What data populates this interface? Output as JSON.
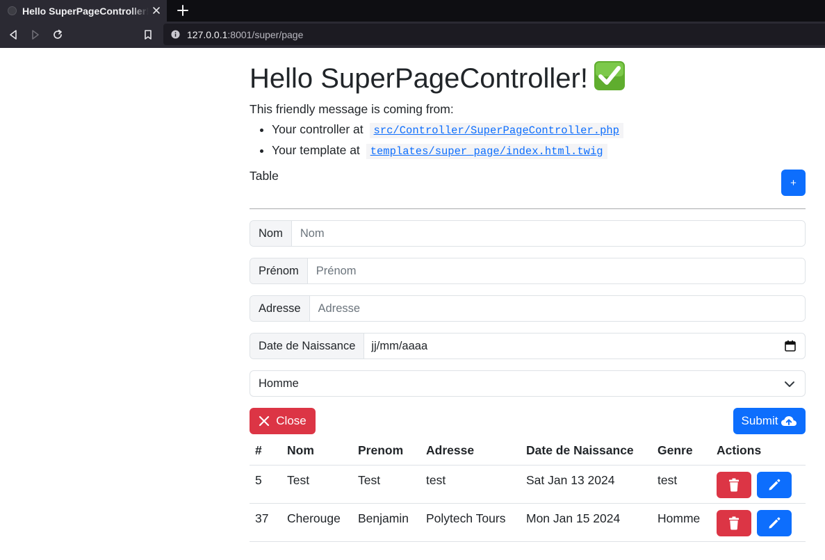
{
  "browser": {
    "tab_title": "Hello SuperPageController!",
    "url_host": "127.0.0.1",
    "url_rest": ":8001/super/page"
  },
  "page": {
    "heading": "Hello SuperPageController!",
    "heading_icon": "check-mark-icon",
    "intro": "This friendly message is coming from:",
    "controller_prefix": "Your controller at",
    "controller_path": "src/Controller/SuperPageController.php",
    "template_prefix": "Your template at",
    "template_path": "templates/super_page/index.html.twig",
    "table_label": "Table",
    "add_button": "+"
  },
  "form": {
    "nom_label": "Nom",
    "nom_placeholder": "Nom",
    "prenom_label": "Prénom",
    "prenom_placeholder": "Prénom",
    "adresse_label": "Adresse",
    "adresse_placeholder": "Adresse",
    "date_label": "Date de Naissance",
    "date_value": "jj/mm/aaaa",
    "genre_selected": "Homme",
    "close_label": "Close",
    "submit_label": "Submit"
  },
  "table": {
    "headers": [
      "#",
      "Nom",
      "Prenom",
      "Adresse",
      "Date de Naissance",
      "Genre",
      "Actions"
    ],
    "rows": [
      {
        "id": "5",
        "nom": "Test",
        "prenom": "Test",
        "adresse": "test",
        "date": "Sat Jan 13 2024",
        "genre": "test"
      },
      {
        "id": "37",
        "nom": "Cherouge",
        "prenom": "Benjamin",
        "adresse": "Polytech Tours",
        "date": "Mon Jan 15 2024",
        "genre": "Homme"
      }
    ]
  },
  "colors": {
    "primary": "#0d6efd",
    "danger": "#dc3545",
    "chrome_dark": "#0e0e12",
    "chrome_bar": "#2b2a33"
  }
}
